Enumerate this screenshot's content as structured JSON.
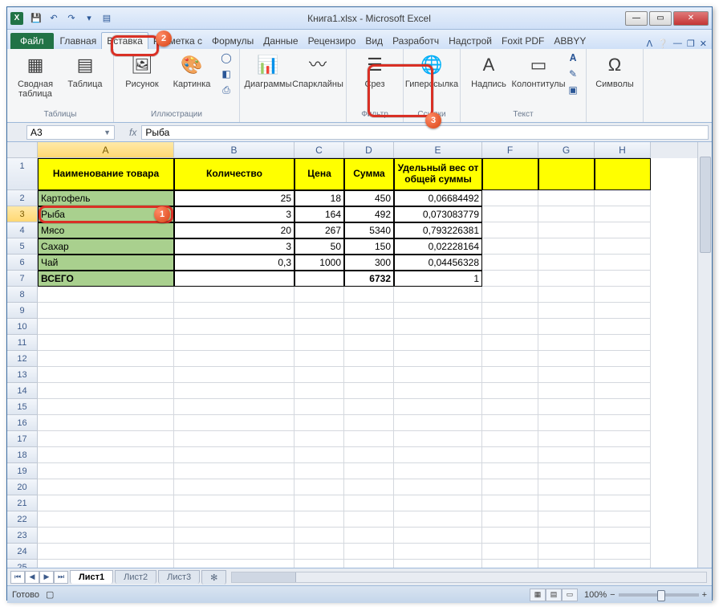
{
  "window": {
    "title": "Книга1.xlsx - Microsoft Excel"
  },
  "tabs": {
    "file": "Файл",
    "items": [
      "Главная",
      "Вставка",
      "Разметка с",
      "Формулы",
      "Данные",
      "Рецензиро",
      "Вид",
      "Разработч",
      "Надстрой",
      "Foxit PDF",
      "ABBYY"
    ],
    "active_index": 1
  },
  "ribbon": {
    "groups": {
      "tables": {
        "label": "Таблицы",
        "pivot": "Сводная таблица",
        "table": "Таблица"
      },
      "illus": {
        "label": "Иллюстрации",
        "pic": "Рисунок",
        "clip": "Картинка"
      },
      "charts": {
        "label": "",
        "chart": "Диаграммы",
        "spark": "Спарклайны"
      },
      "filter": {
        "label": "Фильтр",
        "slicer": "Срез"
      },
      "links": {
        "label": "Ссылки",
        "hyper": "Гиперссылка"
      },
      "text": {
        "label": "Текст",
        "box": "Надпись",
        "hf": "Колонтитулы"
      },
      "symbols": {
        "label": "",
        "sym": "Символы"
      }
    }
  },
  "fbar": {
    "name": "A3",
    "fx": "fx",
    "formula": "Рыба"
  },
  "cols": [
    "A",
    "B",
    "C",
    "D",
    "E",
    "F",
    "G",
    "H"
  ],
  "headers": {
    "A": "Наименование товара",
    "B": "Количество",
    "C": "Цена",
    "D": "Сумма",
    "E": "Удельный вес от общей суммы"
  },
  "rows": [
    {
      "A": "Картофель",
      "B": "25",
      "C": "18",
      "D": "450",
      "E": "0,06684492"
    },
    {
      "A": "Рыба",
      "B": "3",
      "C": "164",
      "D": "492",
      "E": "0,073083779"
    },
    {
      "A": "Мясо",
      "B": "20",
      "C": "267",
      "D": "5340",
      "E": "0,793226381"
    },
    {
      "A": "Сахар",
      "B": "3",
      "C": "50",
      "D": "150",
      "E": "0,02228164"
    },
    {
      "A": "Чай",
      "B": "0,3",
      "C": "1000",
      "D": "300",
      "E": "0,04456328"
    }
  ],
  "total": {
    "A": "ВСЕГО",
    "D": "6732",
    "E": "1"
  },
  "sheets": {
    "items": [
      "Лист1",
      "Лист2",
      "Лист3"
    ],
    "active_index": 0
  },
  "status": {
    "ready": "Готово",
    "zoom": "100%"
  },
  "callouts": {
    "c1": "1",
    "c2": "2",
    "c3": "3"
  }
}
